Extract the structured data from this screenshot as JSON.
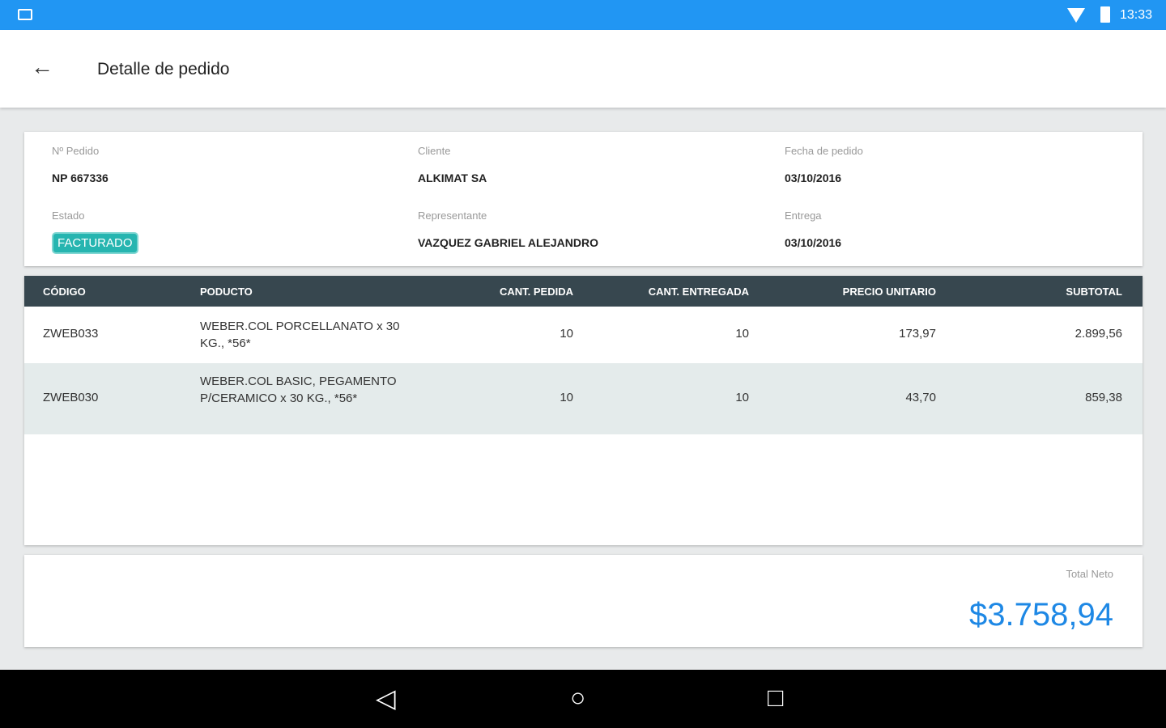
{
  "status_bar": {
    "time": "13:33"
  },
  "header": {
    "title": "Detalle de pedido"
  },
  "info": {
    "pedido_label": "Nº Pedido",
    "pedido": "NP 667336",
    "cliente_label": "Cliente",
    "cliente": "ALKIMAT SA",
    "fecha_label": "Fecha de pedido",
    "fecha": "03/10/2016",
    "estado_label": "Estado",
    "estado": "FACTURADO",
    "representante_label": "Representante",
    "representante": "VAZQUEZ GABRIEL ALEJANDRO",
    "entrega_label": "Entrega",
    "entrega": "03/10/2016"
  },
  "table": {
    "headers": [
      "CÓDIGO",
      "PODUCTO",
      "CANT. PEDIDA",
      "CANT. ENTREGADA",
      "PRECIO UNITARIO",
      "SUBTOTAL"
    ],
    "rows": [
      {
        "codigo": "ZWEB033",
        "producto": "WEBER.COL PORCELLANATO x 30 KG., *56*",
        "pedida": "10",
        "entregada": "10",
        "precio": "173,97",
        "subtotal": "2.899,56"
      },
      {
        "codigo": "ZWEB030",
        "producto": "WEBER.COL BASIC, PEGAMENTO P/CERAMICO x 30 KG., *56*",
        "pedida": "10",
        "entregada": "10",
        "precio": "43,70",
        "subtotal": "859,38"
      }
    ]
  },
  "total": {
    "label": "Total Neto",
    "value": "$3.758,94"
  },
  "colors": {
    "accent": "#2196f3",
    "header": "#37474f",
    "badge": "#26b5b0",
    "total": "#1e88e5"
  }
}
